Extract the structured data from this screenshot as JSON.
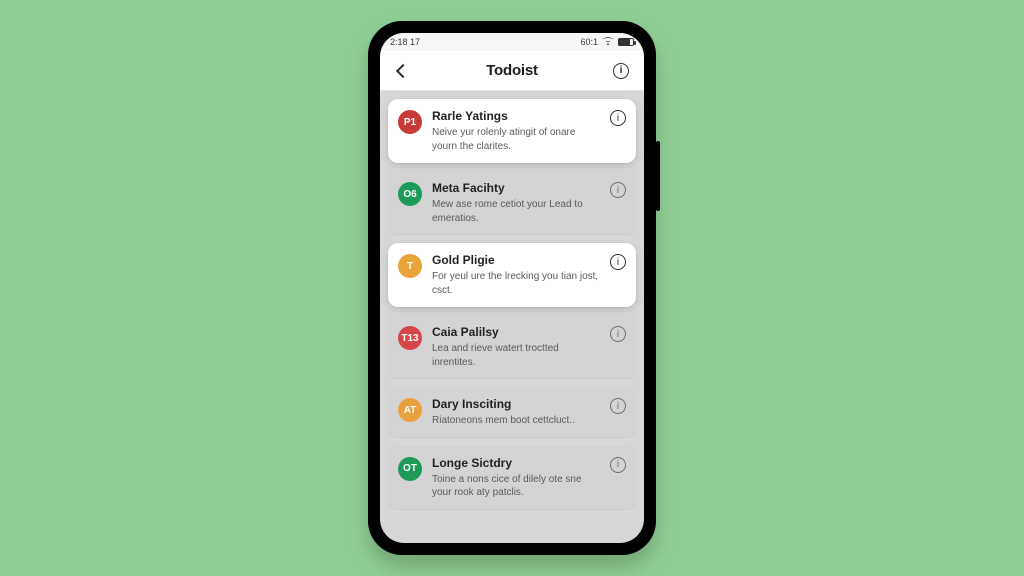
{
  "statusbar": {
    "time": "2:18  17",
    "net": "60:1"
  },
  "header": {
    "title": "Todoist"
  },
  "items": [
    {
      "badge": "P1",
      "color": "c-red",
      "elevated": true,
      "title": "Rarle Yatings",
      "sub": "Neive yur rolenly atingit of onare yourn the clarites."
    },
    {
      "badge": "O6",
      "color": "c-green",
      "elevated": false,
      "title": "Meta Facihty",
      "sub": "Mew ase rome cetiot your Lead to emeratios."
    },
    {
      "badge": "T",
      "color": "c-amber",
      "elevated": true,
      "title": "Gold Pligie",
      "sub": "For yeul ure the lrecking you tian jost, csct."
    },
    {
      "badge": "T13",
      "color": "c-red2",
      "elevated": false,
      "title": "Caia Palilsy",
      "sub": "Lea and rieve watert troctted inrentites."
    },
    {
      "badge": "AT",
      "color": "c-orange",
      "elevated": false,
      "title": "Dary Insciting",
      "sub": "Riatoneons mem boot cettcluct.."
    },
    {
      "badge": "OT",
      "color": "c-green2",
      "elevated": false,
      "title": "Longe Sictdry",
      "sub": "Toine a nons cice of dilely ote sne your rook aty patclis."
    }
  ]
}
